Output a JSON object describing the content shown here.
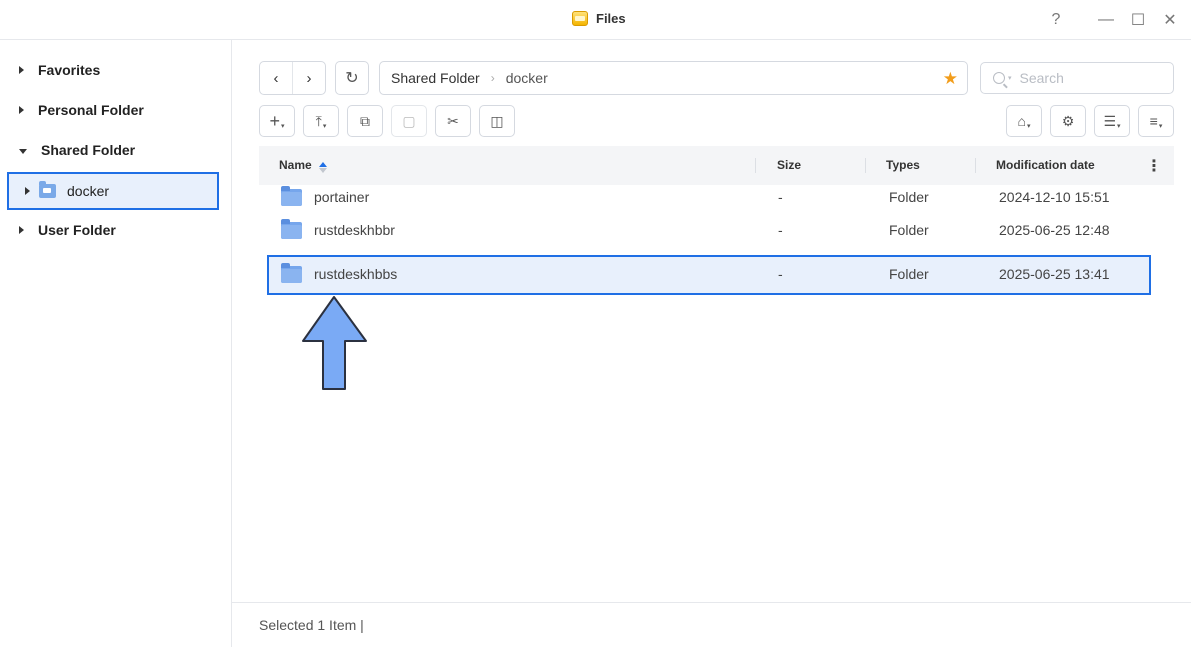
{
  "window": {
    "title": "Files",
    "help_icon": "?",
    "minimize_icon": "—",
    "maximize_icon": "☐",
    "close_icon": "✕"
  },
  "sidebar": {
    "items": [
      {
        "label": "Favorites",
        "expanded": false
      },
      {
        "label": "Personal Folder",
        "expanded": false
      },
      {
        "label": "Shared Folder",
        "expanded": true
      },
      {
        "label": "User Folder",
        "expanded": false
      }
    ],
    "selected_child": {
      "label": "docker",
      "icon": "shared-folder-icon"
    }
  },
  "toolbar": {
    "back_icon": "‹",
    "forward_icon": "›",
    "refresh_icon": "↻",
    "breadcrumb": [
      "Shared Folder",
      "docker"
    ],
    "breadcrumb_separator": "›",
    "favorite_icon": "★",
    "search_placeholder": "Search",
    "create_icon": "+",
    "upload_icon": "⤒",
    "copy_icon": "⧉",
    "paste_icon": "▢",
    "cut_icon": "✂",
    "more_icon": "◫",
    "tools_icon": "⌂",
    "settings_icon": "⚙",
    "view_icon": "☰",
    "sort_icon": "≡"
  },
  "table": {
    "columns": [
      "Name",
      "Size",
      "Types",
      "Modification date"
    ],
    "sort_column": "Name",
    "rows": [
      {
        "name": "portainer",
        "size": "-",
        "type": "Folder",
        "modified": "2024-12-10 15:51",
        "selected": false
      },
      {
        "name": "rustdeskhbbr",
        "size": "-",
        "type": "Folder",
        "modified": "2025-06-25 12:48",
        "selected": false
      },
      {
        "name": "rustdeskhbbs",
        "size": "-",
        "type": "Folder",
        "modified": "2025-06-25 13:41",
        "selected": true
      }
    ],
    "kebab_icon": "⋮"
  },
  "annotation": {
    "icon": "up-arrow",
    "color": "#7aaaf5"
  },
  "status": {
    "text": "Selected 1 Item |"
  },
  "colors": {
    "accent": "#1f6fe5",
    "selection_bg": "#e8f0fc",
    "folder": "#76a6ec",
    "star": "#f29d1b"
  }
}
